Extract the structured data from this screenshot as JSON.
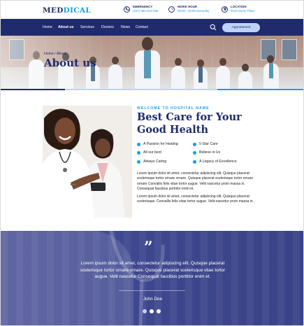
{
  "brand": {
    "part1": "MED",
    "part2": "DICAL",
    "colors": {
      "primary": "#1f2b6c",
      "accent": "#159eec",
      "light": "#bfd2f8"
    }
  },
  "info": [
    {
      "icon": "phone-icon",
      "label": "EMERGENCY",
      "value": "(237) 681-812-255"
    },
    {
      "icon": "clock-icon",
      "label": "WORK HOUR",
      "value": "09:00 - 20:00 Everyday"
    },
    {
      "icon": "location-icon",
      "label": "LOCATION",
      "value": "0123 Some Place"
    }
  ],
  "nav": {
    "links": [
      "Home",
      "About us",
      "Services",
      "Doctors",
      "News",
      "Contact"
    ],
    "active": "About us",
    "appointment": "Appointment"
  },
  "hero": {
    "breadcrumb": "Home / About",
    "title": "About us"
  },
  "about": {
    "kicker": "WELCOME TO HOSPITAL NAME",
    "title": "Best Care for Your Good Health",
    "features_left": [
      "A Passion for Healing",
      "All our best",
      "Always Caring"
    ],
    "features_right": [
      "5-Star Care",
      "Believe in Us",
      "A Legacy of Excellence"
    ],
    "para1": "Lorem ipsum dolor sit amet, consectetur adipiscing elit. Quisque placerat scelerisque tortor ornare ornare. Quisque placerat scelerisque tortor ornare ornare Convallis felis vitae tortor augue. Velit nascetur proin massa in. Consequat faucibus porttitor enim et.",
    "para2": "Lorem ipsum dolor sit amet, consectetur adipiscing elit. Quisque placerat scelerisque. Convallis felis vitae tortor augue. Velit nascetur proin massa in."
  },
  "testimonial": {
    "quote": "Lorem ipsum dolor sit amet, consectetur adipiscing elit. Quisque placerat scelerisque tortor ornare ornare. Quisque placerat scelerisque vitae tortor augue. Velit nascetur Consequat faucibus porttitor enim et.",
    "author": "John Doe",
    "slides": 3,
    "active_slide": 0
  }
}
